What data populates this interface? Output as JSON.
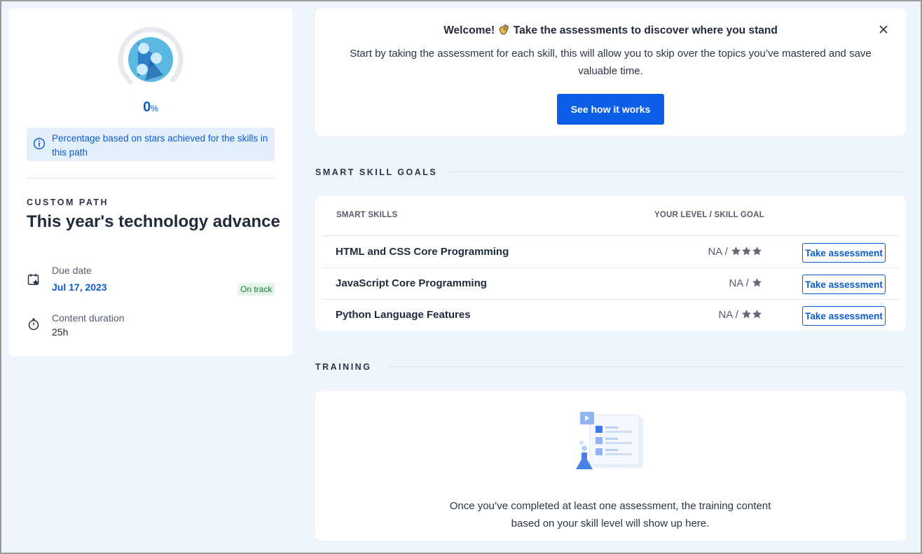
{
  "progress": {
    "value": 0,
    "value_text": "0",
    "unit": "%"
  },
  "info_text": "Percentage based on stars achieved for the skills in this path",
  "path": {
    "kicker": "CUSTOM PATH",
    "title": "This year's technology advance",
    "due_label": "Due date",
    "due_value": "Jul 17, 2023",
    "status_badge": "On track",
    "duration_label": "Content duration",
    "duration_value": "25h"
  },
  "welcome": {
    "title": "Welcome! 👏 Take the assessments to discover where you stand",
    "title_before_emoji": "Welcome!",
    "title_after_emoji": "Take the assessments to discover where you stand",
    "body": "Start by taking the assessment for each skill, this will allow you to skip over the topics you’ve mastered and save valuable time.",
    "cta_label": "See how it works"
  },
  "skill_goals": {
    "heading": "SMART SKILL GOALS",
    "col_skill": "SMART SKILLS",
    "col_level": "YOUR LEVEL / SKILL GOAL",
    "rows": [
      {
        "name": "HTML and CSS Core Programming",
        "level": "NA /",
        "goal_stars": 3,
        "button": "Take assessment"
      },
      {
        "name": "JavaScript Core Programming",
        "level": "NA /",
        "goal_stars": 1,
        "button": "Take assessment"
      },
      {
        "name": "Python Language Features",
        "level": "NA /",
        "goal_stars": 2,
        "button": "Take assessment"
      }
    ]
  },
  "training": {
    "heading": "TRAINING",
    "message": "Once you’ve completed at least one assessment, the training content based on your skill level will show up here."
  },
  "colors": {
    "accent": "#0b5fe6",
    "link_blue": "#0b5ccf",
    "page_bg": "#eef4fb",
    "badge_green_bg": "#e3f5ea",
    "badge_green_text": "#1c7a3a"
  },
  "icons": {
    "calendar": "calendar-star-icon",
    "timer": "stopwatch-icon",
    "info": "info-circle-icon",
    "close": "close-icon",
    "star": "star-icon"
  }
}
